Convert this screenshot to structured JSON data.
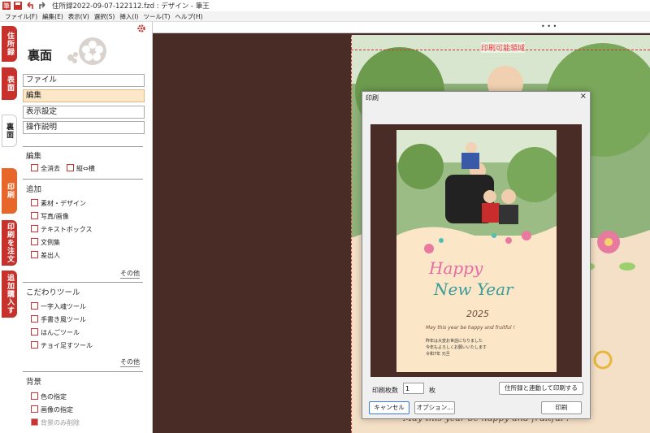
{
  "window": {
    "title": "住所録2022-09-07-122112.fzd : デザイン - 筆王"
  },
  "menu": [
    "ファイル(F)",
    "編集(E)",
    "表示(V)",
    "選択(S)",
    "挿入(I)",
    "ツール(T)",
    "ヘルプ(H)"
  ],
  "tabs": [
    {
      "label": "住所録",
      "color": "#c8312b"
    },
    {
      "label": "表面",
      "color": "#c8312b"
    },
    {
      "label": "裏面",
      "color": "#ffffff"
    },
    {
      "label": "印刷",
      "color": "#e8662a"
    },
    {
      "label": "印刷を注文",
      "color": "#c8312b"
    },
    {
      "label": "追加購入する",
      "color": "#c8312b"
    }
  ],
  "panel": {
    "title": "裏面",
    "nav": [
      "ファイル",
      "編集",
      "表示設定",
      "操作説明"
    ],
    "sections": [
      {
        "head": "編集",
        "items": [
          "全消去",
          "縦⇔横"
        ]
      },
      {
        "head": "追加",
        "items": [
          "素材・デザイン",
          "写真/画像",
          "テキストボックス",
          "文例集",
          "差出人"
        ],
        "more": "その他"
      },
      {
        "head": "こだわりツール",
        "items": [
          "一字入魂ツール",
          "手書き風ツール",
          "はんごツール",
          "チョイ足すツール"
        ],
        "more": "その他"
      },
      {
        "head": "背景",
        "items": [
          "色の指定",
          "画像の指定",
          "背景のみ削除"
        ]
      }
    ]
  },
  "canvas": {
    "print_area_label": "印刷可能領域",
    "ruler_dots": "• • •",
    "bottom_text": "May this year be happy and fruitful !"
  },
  "dialog": {
    "title": "印刷",
    "close": "×",
    "card": {
      "happy": "Happy",
      "newyear": "New Year",
      "year": "2025",
      "en": "May this year be happy and fruitful !",
      "msg1": "昨年は大変お世話になりました",
      "msg2": "今年もよろしくお願いいたします",
      "msg3": "令和7年 元旦"
    },
    "copies_label": "印刷枚数",
    "copies_value": "1",
    "copies_unit": "枚",
    "link_print": "住所録と連動して印刷する",
    "cancel": "キャンセル",
    "options": "オプション...",
    "print": "印刷"
  }
}
